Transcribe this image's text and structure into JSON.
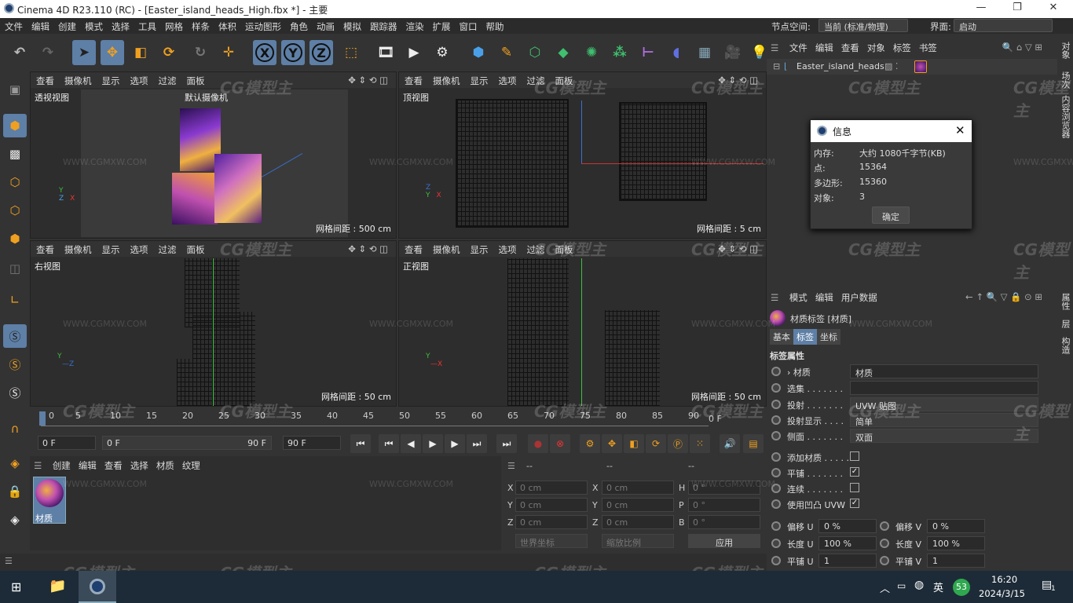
{
  "window": {
    "title": "Cinema 4D R23.110 (RC) - [Easter_island_heads_High.fbx *] - 主要",
    "controls": [
      "—",
      "❐",
      "✕"
    ]
  },
  "menu": [
    "文件",
    "编辑",
    "创建",
    "模式",
    "选择",
    "工具",
    "网格",
    "样条",
    "体积",
    "运动图形",
    "角色",
    "动画",
    "模拟",
    "跟踪器",
    "渲染",
    "扩展",
    "窗口",
    "帮助"
  ],
  "node_space": {
    "label": "节点空间:",
    "value": "当前 (标准/物理)"
  },
  "interface": {
    "label": "界面:",
    "value": "启动"
  },
  "toolbar": {
    "axis": [
      "X",
      "Y",
      "Z"
    ]
  },
  "viewports": [
    {
      "id": "persp",
      "menu": [
        "查看",
        "摄像机",
        "显示",
        "选项",
        "过滤",
        "面板"
      ],
      "name": "透视视图",
      "camera": "默认摄像机",
      "grid": "网格间距 : 500 cm"
    },
    {
      "id": "top",
      "menu": [
        "查看",
        "摄像机",
        "显示",
        "选项",
        "过滤",
        "面板"
      ],
      "name": "顶视图",
      "grid": "网格间距 : 5 cm"
    },
    {
      "id": "right",
      "menu": [
        "查看",
        "摄像机",
        "显示",
        "选项",
        "过滤",
        "面板"
      ],
      "name": "右视图",
      "grid": "网格间距 : 50 cm"
    },
    {
      "id": "front",
      "menu": [
        "查看",
        "摄像机",
        "显示",
        "选项",
        "过滤",
        "面板"
      ],
      "name": "正视图",
      "grid": "网格间距 : 50 cm"
    }
  ],
  "timeline": {
    "ticks": [
      "0",
      "5",
      "10",
      "15",
      "20",
      "25",
      "30",
      "35",
      "40",
      "45",
      "50",
      "55",
      "60",
      "65",
      "70",
      "75",
      "80",
      "85",
      "90"
    ],
    "end": "0 F",
    "start_field": "0 F",
    "range_start": "0 F",
    "range_end": "90 F",
    "end_field": "90 F"
  },
  "materials": {
    "menu": [
      "创建",
      "编辑",
      "查看",
      "选择",
      "材质",
      "纹理"
    ],
    "items": [
      {
        "name": "材质"
      }
    ]
  },
  "coords": {
    "headers": [
      "--",
      "--",
      "--"
    ],
    "rows": [
      {
        "a": "X",
        "av": "0 cm",
        "b": "X",
        "bv": "0 cm",
        "c": "H",
        "cv": "0 °"
      },
      {
        "a": "Y",
        "av": "0 cm",
        "b": "Y",
        "bv": "0 cm",
        "c": "P",
        "cv": "0 °"
      },
      {
        "a": "Z",
        "av": "0 cm",
        "b": "Z",
        "bv": "0 cm",
        "c": "B",
        "cv": "0 °"
      }
    ],
    "world": "世界坐标",
    "scale": "缩放比例",
    "apply": "应用"
  },
  "objects": {
    "menu": [
      "文件",
      "编辑",
      "查看",
      "对象",
      "标签",
      "书签"
    ],
    "items": [
      {
        "name": "Easter_island_heads"
      }
    ]
  },
  "info_dialog": {
    "title": "信息",
    "rows": [
      {
        "k": "内存:",
        "v": "大约 1080千字节(KB)"
      },
      {
        "k": "点:",
        "v": "15364"
      },
      {
        "k": "多边形:",
        "v": "15360"
      },
      {
        "k": "对象:",
        "v": "3"
      }
    ],
    "ok": "确定"
  },
  "attributes": {
    "menu": [
      "模式",
      "编辑",
      "用户数据"
    ],
    "title": "材质标签 [材质]",
    "tabs": [
      "基本",
      "标签",
      "坐标"
    ],
    "active_tab": "标签",
    "section": "标签属性",
    "rows": [
      {
        "label": "› 材质",
        "value": "材质",
        "type": "field"
      },
      {
        "label": "选集 . . . . . . .",
        "value": "",
        "type": "field"
      },
      {
        "label": "投射 . . . . . . .",
        "value": "UVW 贴图",
        "type": "select"
      },
      {
        "label": "投射显示 . . . .",
        "value": "简单",
        "type": "select"
      },
      {
        "label": "侧面 . . . . . . .",
        "value": "双面",
        "type": "select"
      },
      {
        "label": "添加材质 . . . . .",
        "value": "",
        "type": "check"
      },
      {
        "label": "平铺 . . . . . . .",
        "value": "✓",
        "type": "check"
      },
      {
        "label": "连续 . . . . . . .",
        "value": "",
        "type": "check"
      },
      {
        "label": "使用凹凸 UVW",
        "value": "✓",
        "type": "check"
      }
    ],
    "pairs": [
      {
        "l1": "偏移 U",
        "v1": "0 %",
        "l2": "偏移 V",
        "v2": "0 %"
      },
      {
        "l1": "长度 U",
        "v1": "100 %",
        "l2": "长度 V",
        "v2": "100 %"
      },
      {
        "l1": "平铺 U",
        "v1": "1",
        "l2": "平铺 V",
        "v2": "1"
      }
    ]
  },
  "side_tabs_top": [
    "对象",
    "场次",
    "内容浏览器"
  ],
  "side_tabs_bottom": [
    "属性",
    "层",
    "构造"
  ],
  "taskbar": {
    "ime": "英",
    "badge": "53",
    "time": "16:20",
    "date": "2024/3/15",
    "notif": "1"
  },
  "watermark": {
    "logo": "CG模型主",
    "url": "WWW.CGMXW.COM"
  },
  "colors": {
    "accent": "#5e7fa6",
    "bg": "#333333",
    "green": "#3fbf3f",
    "red": "#d33"
  }
}
